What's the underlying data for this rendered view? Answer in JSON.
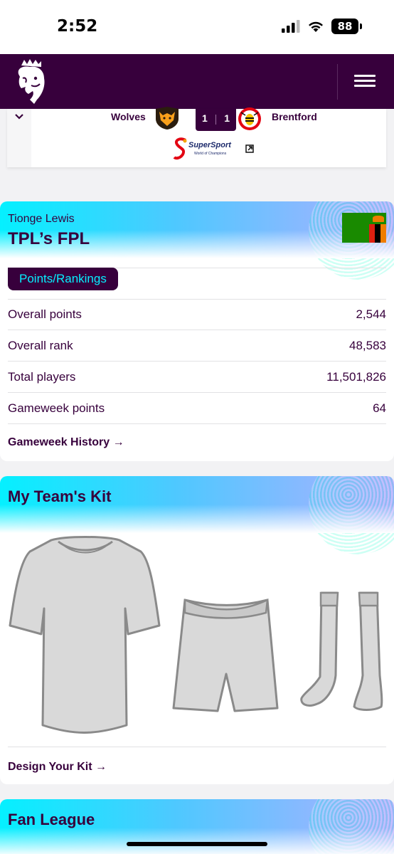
{
  "status_bar": {
    "time": "2:52",
    "battery": "88"
  },
  "header": {
    "logo": "premier-league-lion-logo",
    "menu_icon": "hamburger-menu-icon"
  },
  "match": {
    "home_team": "Wolves",
    "away_team": "Brentford",
    "home_score": "1",
    "away_score": "1",
    "broadcaster": "SuperSport",
    "broadcaster_tagline": "World of Champions"
  },
  "fpl": {
    "manager_name": "Tionge Lewis",
    "team_name": "TPL’s FPL",
    "tab_label": "Points/Rankings",
    "stats": [
      {
        "label": "Overall points",
        "value": "2,544"
      },
      {
        "label": "Overall rank",
        "value": "48,583"
      },
      {
        "label": "Total players",
        "value": "11,501,826"
      },
      {
        "label": "Gameweek points",
        "value": "64"
      }
    ],
    "history_link": "Gameweek History →"
  },
  "kit": {
    "title": "My Team's Kit",
    "design_link": "Design Your Kit →"
  },
  "fan_league": {
    "title": "Fan League"
  },
  "colors": {
    "brand_purple": "#37003c",
    "accent_cyan": "#05f0ff",
    "zambia_green": "#198a00",
    "kit_grey": "#d9d9d9"
  }
}
